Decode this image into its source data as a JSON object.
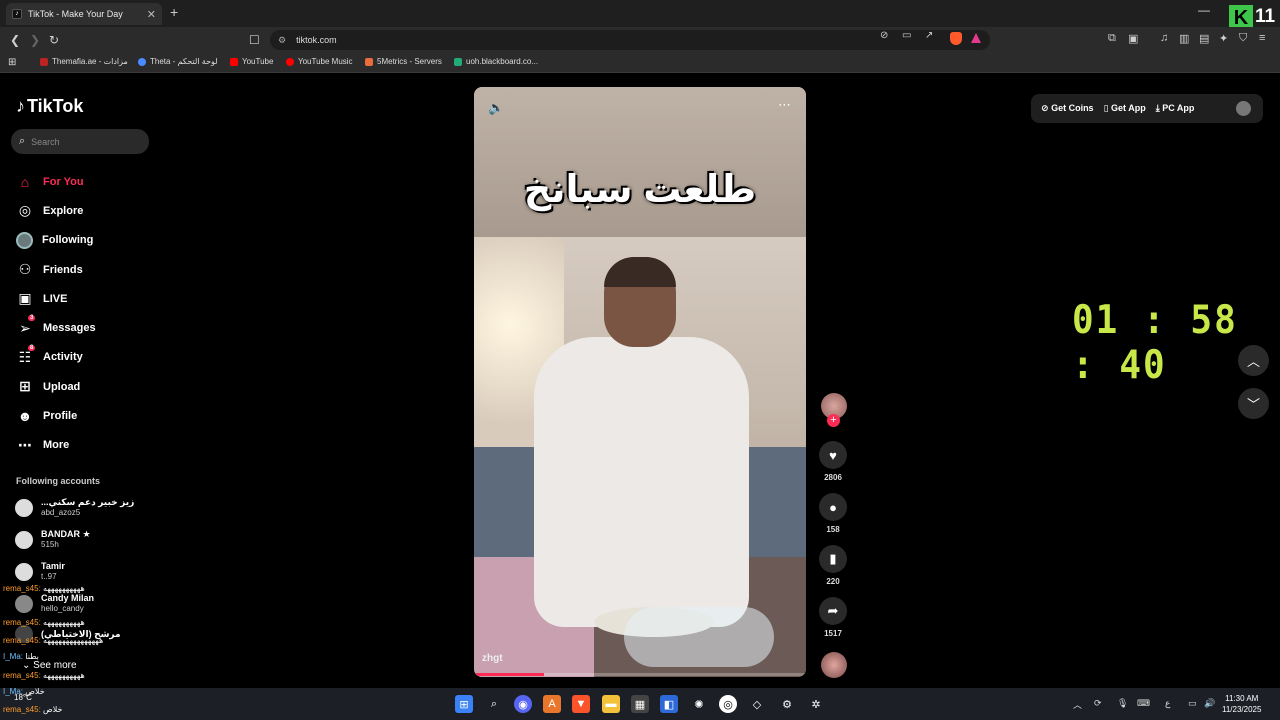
{
  "browser": {
    "tab_title": "TikTok - Make Your Day",
    "url": "tiktok.com",
    "bookmarks": [
      "Themafia.ae - مزادات",
      "Theta - لوحة التحكم",
      "YouTube",
      "YouTube Music",
      "5Metrics - Servers",
      "uoh.blackboard.co..."
    ],
    "overlay_number": "11"
  },
  "sidebar": {
    "logo": "TikTok",
    "search_placeholder": "Search",
    "nav": [
      {
        "label": "For You",
        "icon": "home-icon",
        "active": true
      },
      {
        "label": "Explore",
        "icon": "compass-icon"
      },
      {
        "label": "Following",
        "icon": "following-avatar"
      },
      {
        "label": "Friends",
        "icon": "friends-icon"
      },
      {
        "label": "LIVE",
        "icon": "live-icon"
      },
      {
        "label": "Messages",
        "icon": "messages-icon",
        "badge": "3"
      },
      {
        "label": "Activity",
        "icon": "activity-icon",
        "badge": "8"
      },
      {
        "label": "Upload",
        "icon": "upload-icon"
      },
      {
        "label": "Profile",
        "icon": "profile-icon"
      },
      {
        "label": "More",
        "icon": "more-icon"
      }
    ],
    "following_title": "Following accounts",
    "accounts": [
      {
        "name": "...زيز خبير دعم سكني",
        "handle": "abd_azoz5"
      },
      {
        "name": "BANDAR ★",
        "handle": "515h"
      },
      {
        "name": "Tamir",
        "handle": "t..97"
      },
      {
        "name": "Candy Milan",
        "handle": "hello_candy"
      },
      {
        "name": "مرشح (الاختياطي)",
        "handle": ""
      }
    ],
    "see_more": "See more"
  },
  "stream_overlay": {
    "lines": [
      {
        "user": "rema_s45:",
        "text": "ههههههههههه"
      },
      {
        "user": "rema_s45:",
        "text": "ههههههههههه"
      },
      {
        "user": "rema_s45:",
        "text": "هههههههههههههههه"
      },
      {
        "user": "I_Ma:",
        "text": "بطنا"
      },
      {
        "user": "rema_s45:",
        "text": "ههههههههههه"
      },
      {
        "user": "I_Ma:",
        "text": "خلاص"
      },
      {
        "user": "rema_s45:",
        "text": "خلاص"
      }
    ]
  },
  "video": {
    "caption": "طلعت سبانخ",
    "watermark": "zhgt",
    "progress": 0.21
  },
  "actions": {
    "likes": "2806",
    "comments": "158",
    "saves": "220",
    "shares": "1517"
  },
  "topbar": {
    "get_coins": "Get Coins",
    "get_app": "Get App",
    "pc_app": "PC App"
  },
  "timer": {
    "h": "01",
    "m": "58",
    "s": "40"
  },
  "taskbar": {
    "weather": "18°C",
    "time": "11:30 AM",
    "date": "11/23/2025",
    "lang": "ع"
  },
  "colors": {
    "accent": "#fe2c55",
    "timer": "#c8e84a"
  }
}
